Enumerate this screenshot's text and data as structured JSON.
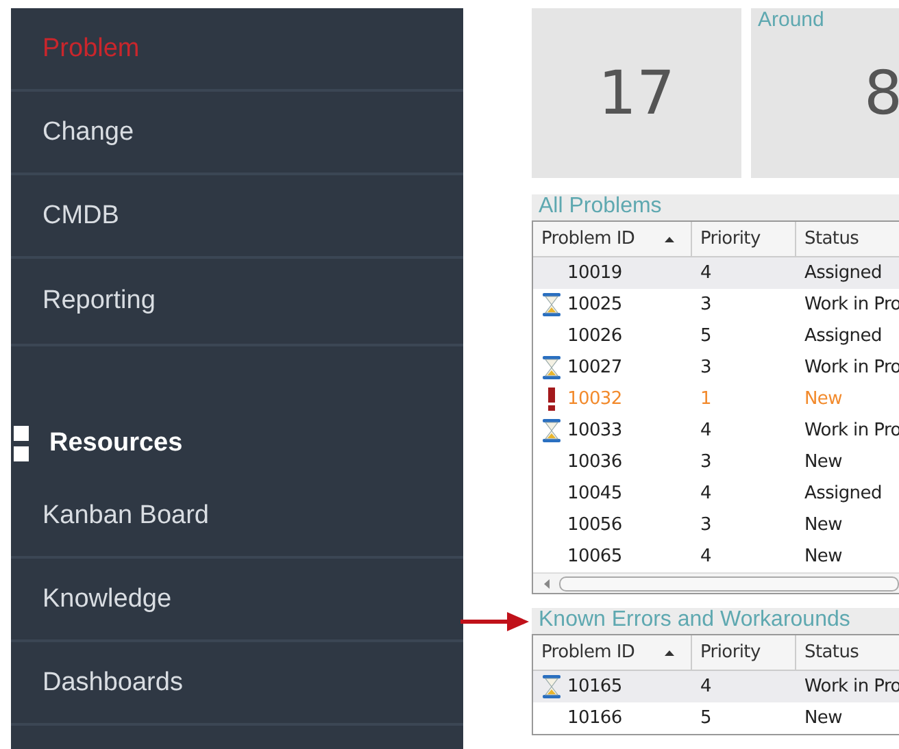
{
  "sidebar": {
    "items": [
      {
        "label": "Problem",
        "selected": true
      },
      {
        "label": "Change",
        "selected": false
      },
      {
        "label": "CMDB",
        "selected": false
      },
      {
        "label": "Reporting",
        "selected": false
      }
    ],
    "section": {
      "label": "Resources"
    },
    "section_items": [
      {
        "label": "Kanban Board",
        "selected": false
      },
      {
        "label": "Knowledge",
        "selected": false
      },
      {
        "label": "Dashboards",
        "selected": false
      }
    ]
  },
  "tiles": [
    {
      "value": "17"
    },
    {
      "caption": "Around",
      "value": "8"
    }
  ],
  "panels": [
    {
      "title": "All Problems",
      "annotated": false,
      "scrollbar": true,
      "columns": [
        {
          "label": "Problem ID",
          "sorted": true
        },
        {
          "label": "Priority",
          "sorted": false
        },
        {
          "label": "Status",
          "sorted": false
        }
      ],
      "rows": [
        {
          "kind": "plain",
          "selected": true,
          "cells": [
            "10019",
            "4",
            "Assigned"
          ]
        },
        {
          "kind": "waiting",
          "selected": false,
          "cells": [
            "10025",
            "3",
            "Work in Pro"
          ]
        },
        {
          "kind": "plain",
          "selected": false,
          "cells": [
            "10026",
            "5",
            "Assigned"
          ]
        },
        {
          "kind": "waiting",
          "selected": false,
          "cells": [
            "10027",
            "3",
            "Work in Pro"
          ]
        },
        {
          "kind": "urgent",
          "selected": false,
          "cells": [
            "10032",
            "1",
            "New"
          ]
        },
        {
          "kind": "waiting",
          "selected": false,
          "cells": [
            "10033",
            "4",
            "Work in Pro"
          ]
        },
        {
          "kind": "plain",
          "selected": false,
          "cells": [
            "10036",
            "3",
            "New"
          ]
        },
        {
          "kind": "plain",
          "selected": false,
          "cells": [
            "10045",
            "4",
            "Assigned"
          ]
        },
        {
          "kind": "plain",
          "selected": false,
          "cells": [
            "10056",
            "3",
            "New"
          ]
        },
        {
          "kind": "plain",
          "selected": false,
          "cells": [
            "10065",
            "4",
            "New"
          ]
        }
      ]
    },
    {
      "title": "Known Errors and Workarounds",
      "annotated": true,
      "scrollbar": false,
      "columns": [
        {
          "label": "Problem ID",
          "sorted": true
        },
        {
          "label": "Priority",
          "sorted": false
        },
        {
          "label": "Status",
          "sorted": false
        }
      ],
      "rows": [
        {
          "kind": "waiting",
          "selected": true,
          "cells": [
            "10165",
            "4",
            "Work in Pro"
          ]
        },
        {
          "kind": "plain",
          "selected": false,
          "cells": [
            "10166",
            "5",
            "New"
          ]
        }
      ]
    }
  ]
}
